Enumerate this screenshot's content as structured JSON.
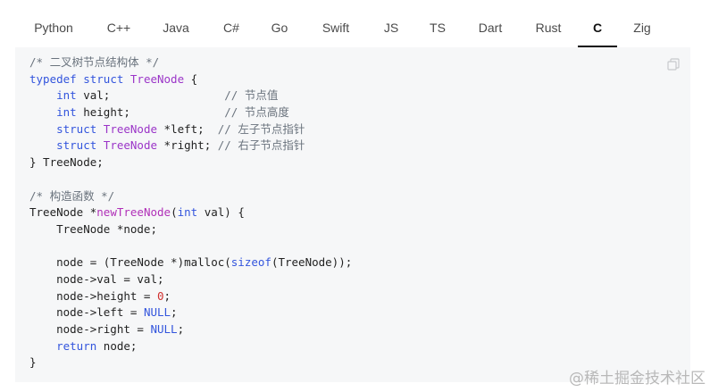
{
  "tabs": {
    "items": [
      "Python",
      "C++",
      "Java",
      "C#",
      "Go",
      "Swift",
      "JS",
      "TS",
      "Dart",
      "Rust",
      "C",
      "Zig"
    ],
    "active": "C"
  },
  "code": {
    "lines": [
      [
        [
          "cm",
          "/* 二叉树节点结构体 */"
        ]
      ],
      [
        [
          "kw",
          "typedef"
        ],
        [
          "",
          " "
        ],
        [
          "kw",
          "struct"
        ],
        [
          "",
          " "
        ],
        [
          "ty",
          "TreeNode"
        ],
        [
          "",
          " {"
        ]
      ],
      [
        [
          "",
          "    "
        ],
        [
          "kw",
          "int"
        ],
        [
          "",
          " val;                 "
        ],
        [
          "cm",
          "// 节点值"
        ]
      ],
      [
        [
          "",
          "    "
        ],
        [
          "kw",
          "int"
        ],
        [
          "",
          " height;              "
        ],
        [
          "cm",
          "// 节点高度"
        ]
      ],
      [
        [
          "",
          "    "
        ],
        [
          "kw",
          "struct"
        ],
        [
          "",
          " "
        ],
        [
          "ty",
          "TreeNode"
        ],
        [
          "",
          " *left;  "
        ],
        [
          "cm",
          "// 左子节点指针"
        ]
      ],
      [
        [
          "",
          "    "
        ],
        [
          "kw",
          "struct"
        ],
        [
          "",
          " "
        ],
        [
          "ty",
          "TreeNode"
        ],
        [
          "",
          " *right; "
        ],
        [
          "cm",
          "// 右子节点指针"
        ]
      ],
      [
        [
          "",
          "} TreeNode;"
        ]
      ],
      [
        [
          "",
          ""
        ]
      ],
      [
        [
          "cm",
          "/* 构造函数 */"
        ]
      ],
      [
        [
          "",
          "TreeNode *"
        ],
        [
          "fn",
          "newTreeNode"
        ],
        [
          "",
          "("
        ],
        [
          "kw",
          "int"
        ],
        [
          "",
          " val) {"
        ]
      ],
      [
        [
          "",
          "    TreeNode *node;"
        ]
      ],
      [
        [
          "",
          ""
        ]
      ],
      [
        [
          "",
          "    node = (TreeNode *)malloc("
        ],
        [
          "kw",
          "sizeof"
        ],
        [
          "",
          "(TreeNode));"
        ]
      ],
      [
        [
          "",
          "    node->val = val;"
        ]
      ],
      [
        [
          "",
          "    node->height = "
        ],
        [
          "num",
          "0"
        ],
        [
          "",
          ";"
        ]
      ],
      [
        [
          "",
          "    node->left = "
        ],
        [
          "nl",
          "NULL"
        ],
        [
          "",
          ";"
        ]
      ],
      [
        [
          "",
          "    node->right = "
        ],
        [
          "nl",
          "NULL"
        ],
        [
          "",
          ";"
        ]
      ],
      [
        [
          "",
          "    "
        ],
        [
          "kw",
          "return"
        ],
        [
          "",
          " node;"
        ]
      ],
      [
        [
          "",
          "}"
        ]
      ]
    ]
  },
  "copy_button": {
    "icon": "copy-icon"
  },
  "watermark": "@稀土掘金技术社区"
}
